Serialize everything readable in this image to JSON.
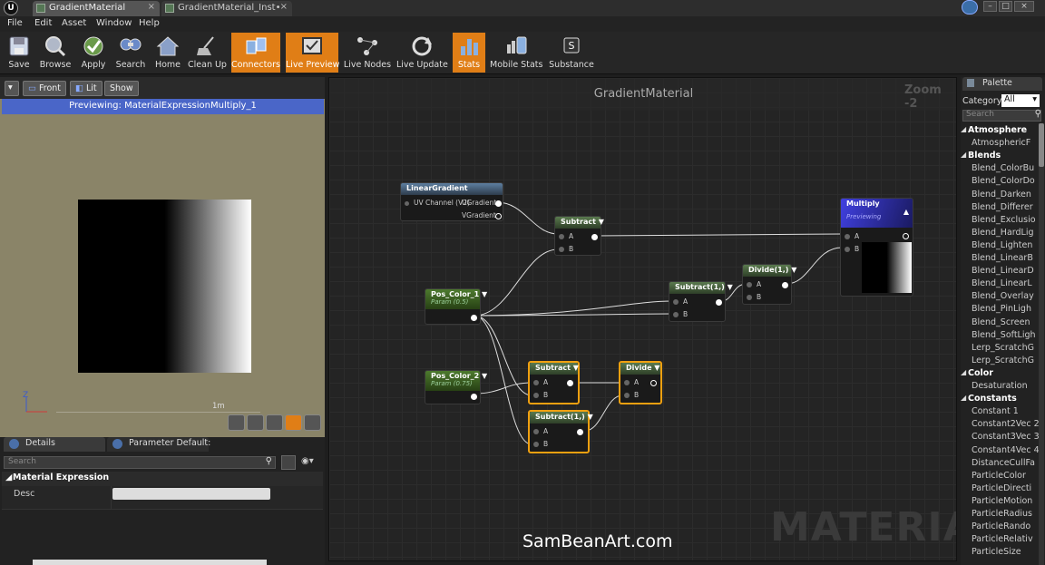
{
  "titlebar": {
    "logo": "U",
    "tabs": [
      {
        "label": "GradientMaterial"
      },
      {
        "label": "GradientMaterial_Inst•"
      }
    ]
  },
  "menu": [
    "File",
    "Edit",
    "Asset",
    "Window",
    "Help"
  ],
  "toolbar": [
    {
      "label": "Save",
      "icon": "save-icon"
    },
    {
      "label": "Browse",
      "icon": "browse-icon"
    },
    {
      "label": "Apply",
      "icon": "apply-icon"
    },
    {
      "label": "Search",
      "icon": "search-icon"
    },
    {
      "label": "Home",
      "icon": "home-icon"
    },
    {
      "label": "Clean Up",
      "icon": "clean-up-icon"
    },
    {
      "label": "Connectors",
      "icon": "connectors-icon",
      "active": true
    },
    {
      "label": "Live Preview",
      "icon": "live-preview-icon",
      "active": true
    },
    {
      "label": "Live Nodes",
      "icon": "live-nodes-icon"
    },
    {
      "label": "Live Update",
      "icon": "live-update-icon"
    },
    {
      "label": "Stats",
      "icon": "stats-icon",
      "active": true
    },
    {
      "label": "Mobile Stats",
      "icon": "mobile-stats-icon"
    },
    {
      "label": "Substance",
      "icon": "substance-icon"
    }
  ],
  "preview": {
    "buttons": {
      "front": "Front",
      "lit": "Lit",
      "show": "Show"
    },
    "status": "Previewing: MaterialExpressionMultiply_1",
    "scale": "1m",
    "axis_z": "Z"
  },
  "details": {
    "tabs": [
      "Details",
      "Parameter Default:"
    ],
    "search_placeholder": "Search",
    "section": "Material Expression",
    "desc_label": "Desc",
    "desc_value": ""
  },
  "graph": {
    "title": "GradientMaterial",
    "zoom": "Zoom -2",
    "watermark": "MATERIAL",
    "credit": "SamBeanArt.com",
    "nodes": {
      "linear_gradient": {
        "title": "LinearGradient",
        "in_label": "UV Channel (V2)",
        "out1": "UGradient",
        "out2": "VGradient"
      },
      "subtract_top": {
        "title": "Subtract",
        "a": "A",
        "b": "B"
      },
      "pos_color_1": {
        "title": "Pos_Color_1",
        "sub": "Param (0.5)"
      },
      "pos_color_2": {
        "title": "Pos_Color_2",
        "sub": "Param (0.75)"
      },
      "subtract_mid": {
        "title": "Subtract(1,)",
        "a": "A",
        "b": "B"
      },
      "divide_top": {
        "title": "Divide(1,)",
        "a": "A",
        "b": "B"
      },
      "multiply": {
        "title": "Multiply",
        "sub": "Previewing",
        "a": "A",
        "b": "B"
      },
      "subtract_low": {
        "title": "Subtract",
        "a": "A",
        "b": "B"
      },
      "divide_low": {
        "title": "Divide",
        "a": "A",
        "b": "B"
      },
      "subtract_bottom": {
        "title": "Subtract(1,)",
        "a": "A",
        "b": "B"
      }
    }
  },
  "palette": {
    "title": "Palette",
    "category_label": "Category:",
    "category_value": "All",
    "search_placeholder": "Search",
    "items": [
      {
        "text": "Atmosphere",
        "cat": true
      },
      {
        "text": "AtmosphericF",
        "cat": false
      },
      {
        "text": "Blends",
        "cat": true
      },
      {
        "text": "Blend_ColorBu",
        "cat": false
      },
      {
        "text": "Blend_ColorDo",
        "cat": false
      },
      {
        "text": "Blend_Darken",
        "cat": false
      },
      {
        "text": "Blend_Differer",
        "cat": false
      },
      {
        "text": "Blend_Exclusio",
        "cat": false
      },
      {
        "text": "Blend_HardLig",
        "cat": false
      },
      {
        "text": "Blend_Lighten",
        "cat": false
      },
      {
        "text": "Blend_LinearB",
        "cat": false
      },
      {
        "text": "Blend_LinearD",
        "cat": false
      },
      {
        "text": "Blend_LinearL",
        "cat": false
      },
      {
        "text": "Blend_Overlay",
        "cat": false
      },
      {
        "text": "Blend_PinLigh",
        "cat": false
      },
      {
        "text": "Blend_Screen",
        "cat": false
      },
      {
        "text": "Blend_SoftLigh",
        "cat": false
      },
      {
        "text": "Lerp_ScratchG",
        "cat": false
      },
      {
        "text": "Lerp_ScratchG",
        "cat": false
      },
      {
        "text": "Color",
        "cat": true
      },
      {
        "text": "Desaturation",
        "cat": false
      },
      {
        "text": "Constants",
        "cat": true
      },
      {
        "text": "Constant         1",
        "cat": false
      },
      {
        "text": "Constant2Vec 2",
        "cat": false
      },
      {
        "text": "Constant3Vec 3",
        "cat": false
      },
      {
        "text": "Constant4Vec 4",
        "cat": false
      },
      {
        "text": "DistanceCullFa",
        "cat": false
      },
      {
        "text": "ParticleColor",
        "cat": false
      },
      {
        "text": "ParticleDirecti",
        "cat": false
      },
      {
        "text": "ParticleMotion",
        "cat": false
      },
      {
        "text": "ParticleRadius",
        "cat": false
      },
      {
        "text": "ParticleRando",
        "cat": false
      },
      {
        "text": "ParticleRelativ",
        "cat": false
      },
      {
        "text": "ParticleSize",
        "cat": false
      }
    ]
  }
}
